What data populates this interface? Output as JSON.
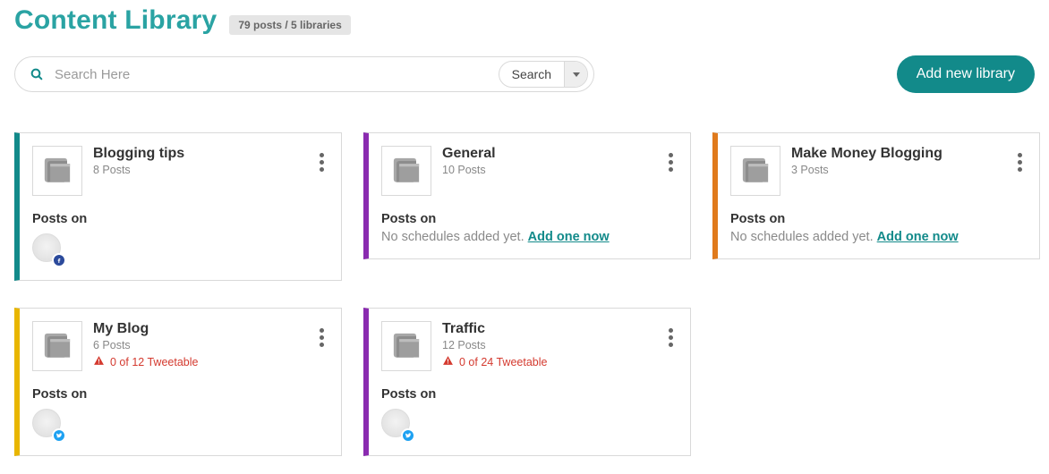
{
  "page_title": "Content Library",
  "summary_badge": "79 posts / 5 libraries",
  "search": {
    "placeholder": "Search Here",
    "kind_label": "Search"
  },
  "add_button": "Add new library",
  "labels": {
    "posts_on": "Posts on",
    "no_schedules": "No schedules added yet.",
    "add_one": "Add one now"
  },
  "accent_colors": {
    "teal": "#128a8a",
    "purple": "#8a2bb0",
    "orange": "#e07a1c",
    "yellow": "#e8b600"
  },
  "cards": [
    {
      "title": "Blogging tips",
      "sub": "8 Posts",
      "accent": "teal",
      "warning": null,
      "network": "facebook",
      "has_schedule": true
    },
    {
      "title": "General",
      "sub": "10 Posts",
      "accent": "purple",
      "warning": null,
      "network": null,
      "has_schedule": false
    },
    {
      "title": "Make Money Blogging",
      "sub": "3 Posts",
      "accent": "orange",
      "warning": null,
      "network": null,
      "has_schedule": false
    },
    {
      "title": "My Blog",
      "sub": "6 Posts",
      "accent": "yellow",
      "warning": "0 of 12 Tweetable",
      "network": "twitter",
      "has_schedule": true
    },
    {
      "title": "Traffic",
      "sub": "12 Posts",
      "accent": "purple",
      "warning": "0 of 24 Tweetable",
      "network": "twitter",
      "has_schedule": true
    }
  ]
}
